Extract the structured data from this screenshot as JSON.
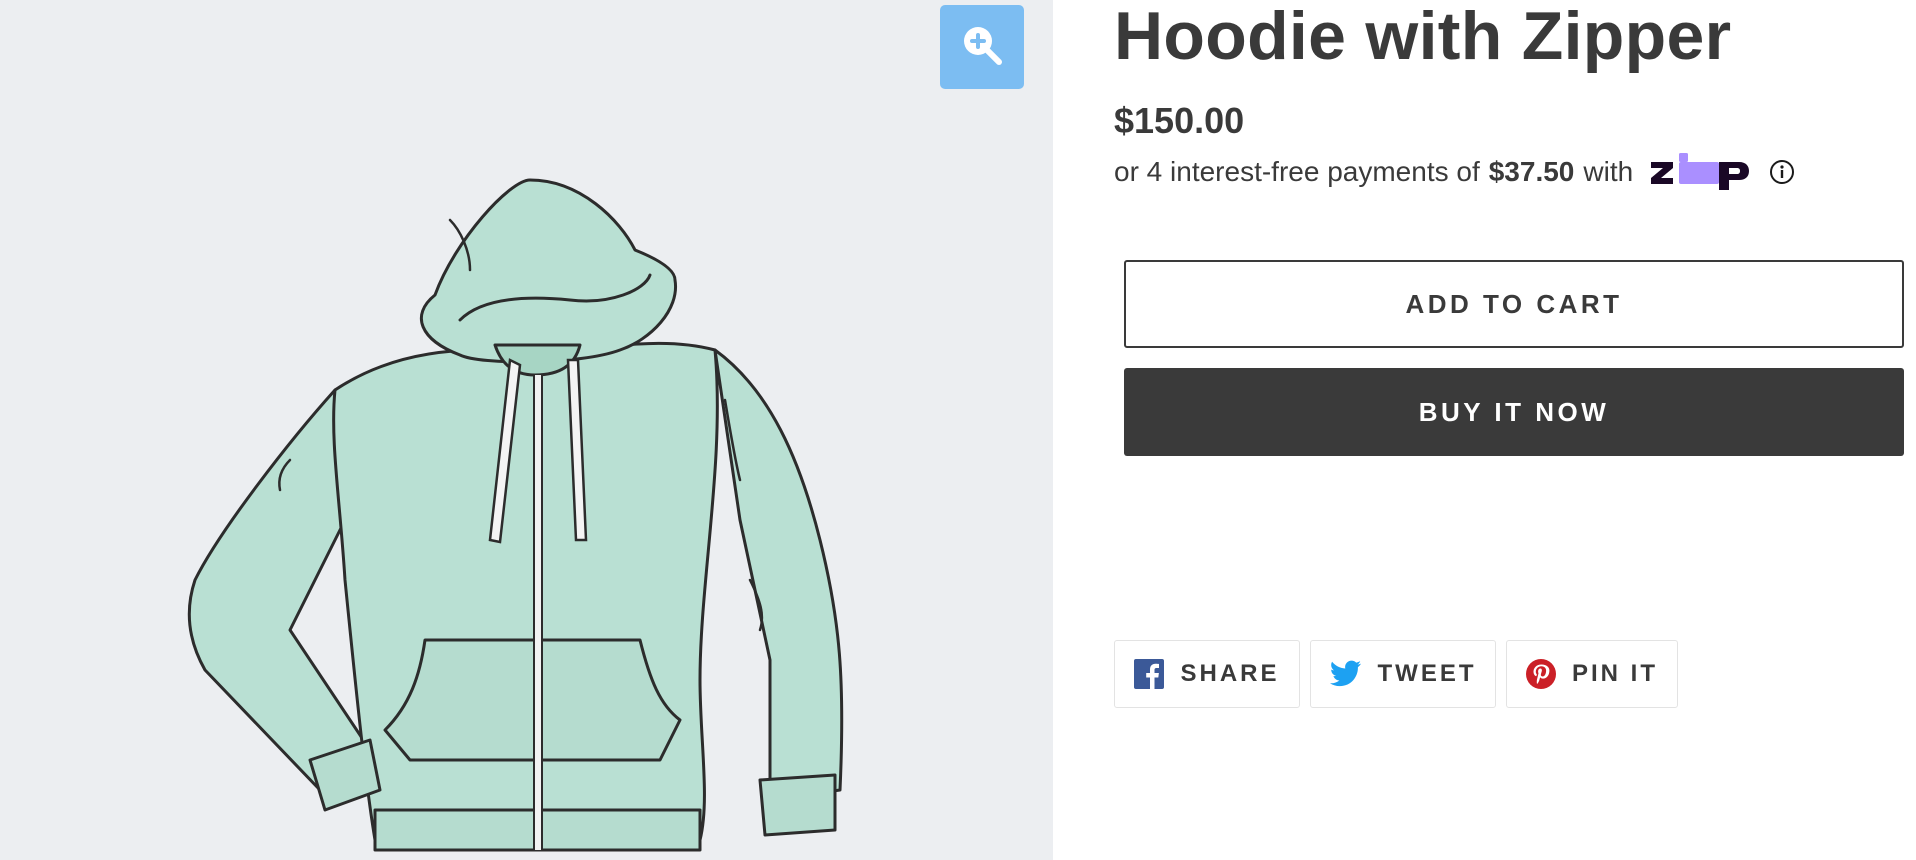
{
  "product": {
    "title": "Hoodie with Zipper",
    "price": "$150.00",
    "image_name": "hoodie-illustration",
    "garment_color": "#b9e0d3"
  },
  "installments": {
    "prefix": "or 4 interest-free payments of",
    "amount": "$37.50",
    "suffix": "with",
    "provider_logo": "zip-logo",
    "info_icon": "info-icon"
  },
  "actions": {
    "add_to_cart": "ADD TO CART",
    "buy_now": "BUY IT NOW"
  },
  "social": {
    "share": "SHARE",
    "tweet": "TWEET",
    "pin": "PIN IT"
  },
  "colors": {
    "text": "#3a3a3a",
    "buy_button": "#3a3a3a",
    "zoom_button": "#7cbdf2",
    "media_background": "#eceef1",
    "facebook": "#3b5998",
    "twitter": "#1da1f2",
    "pinterest": "#cb2027",
    "zip_dark": "#1a0826",
    "zip_purple": "#aa8fff"
  }
}
